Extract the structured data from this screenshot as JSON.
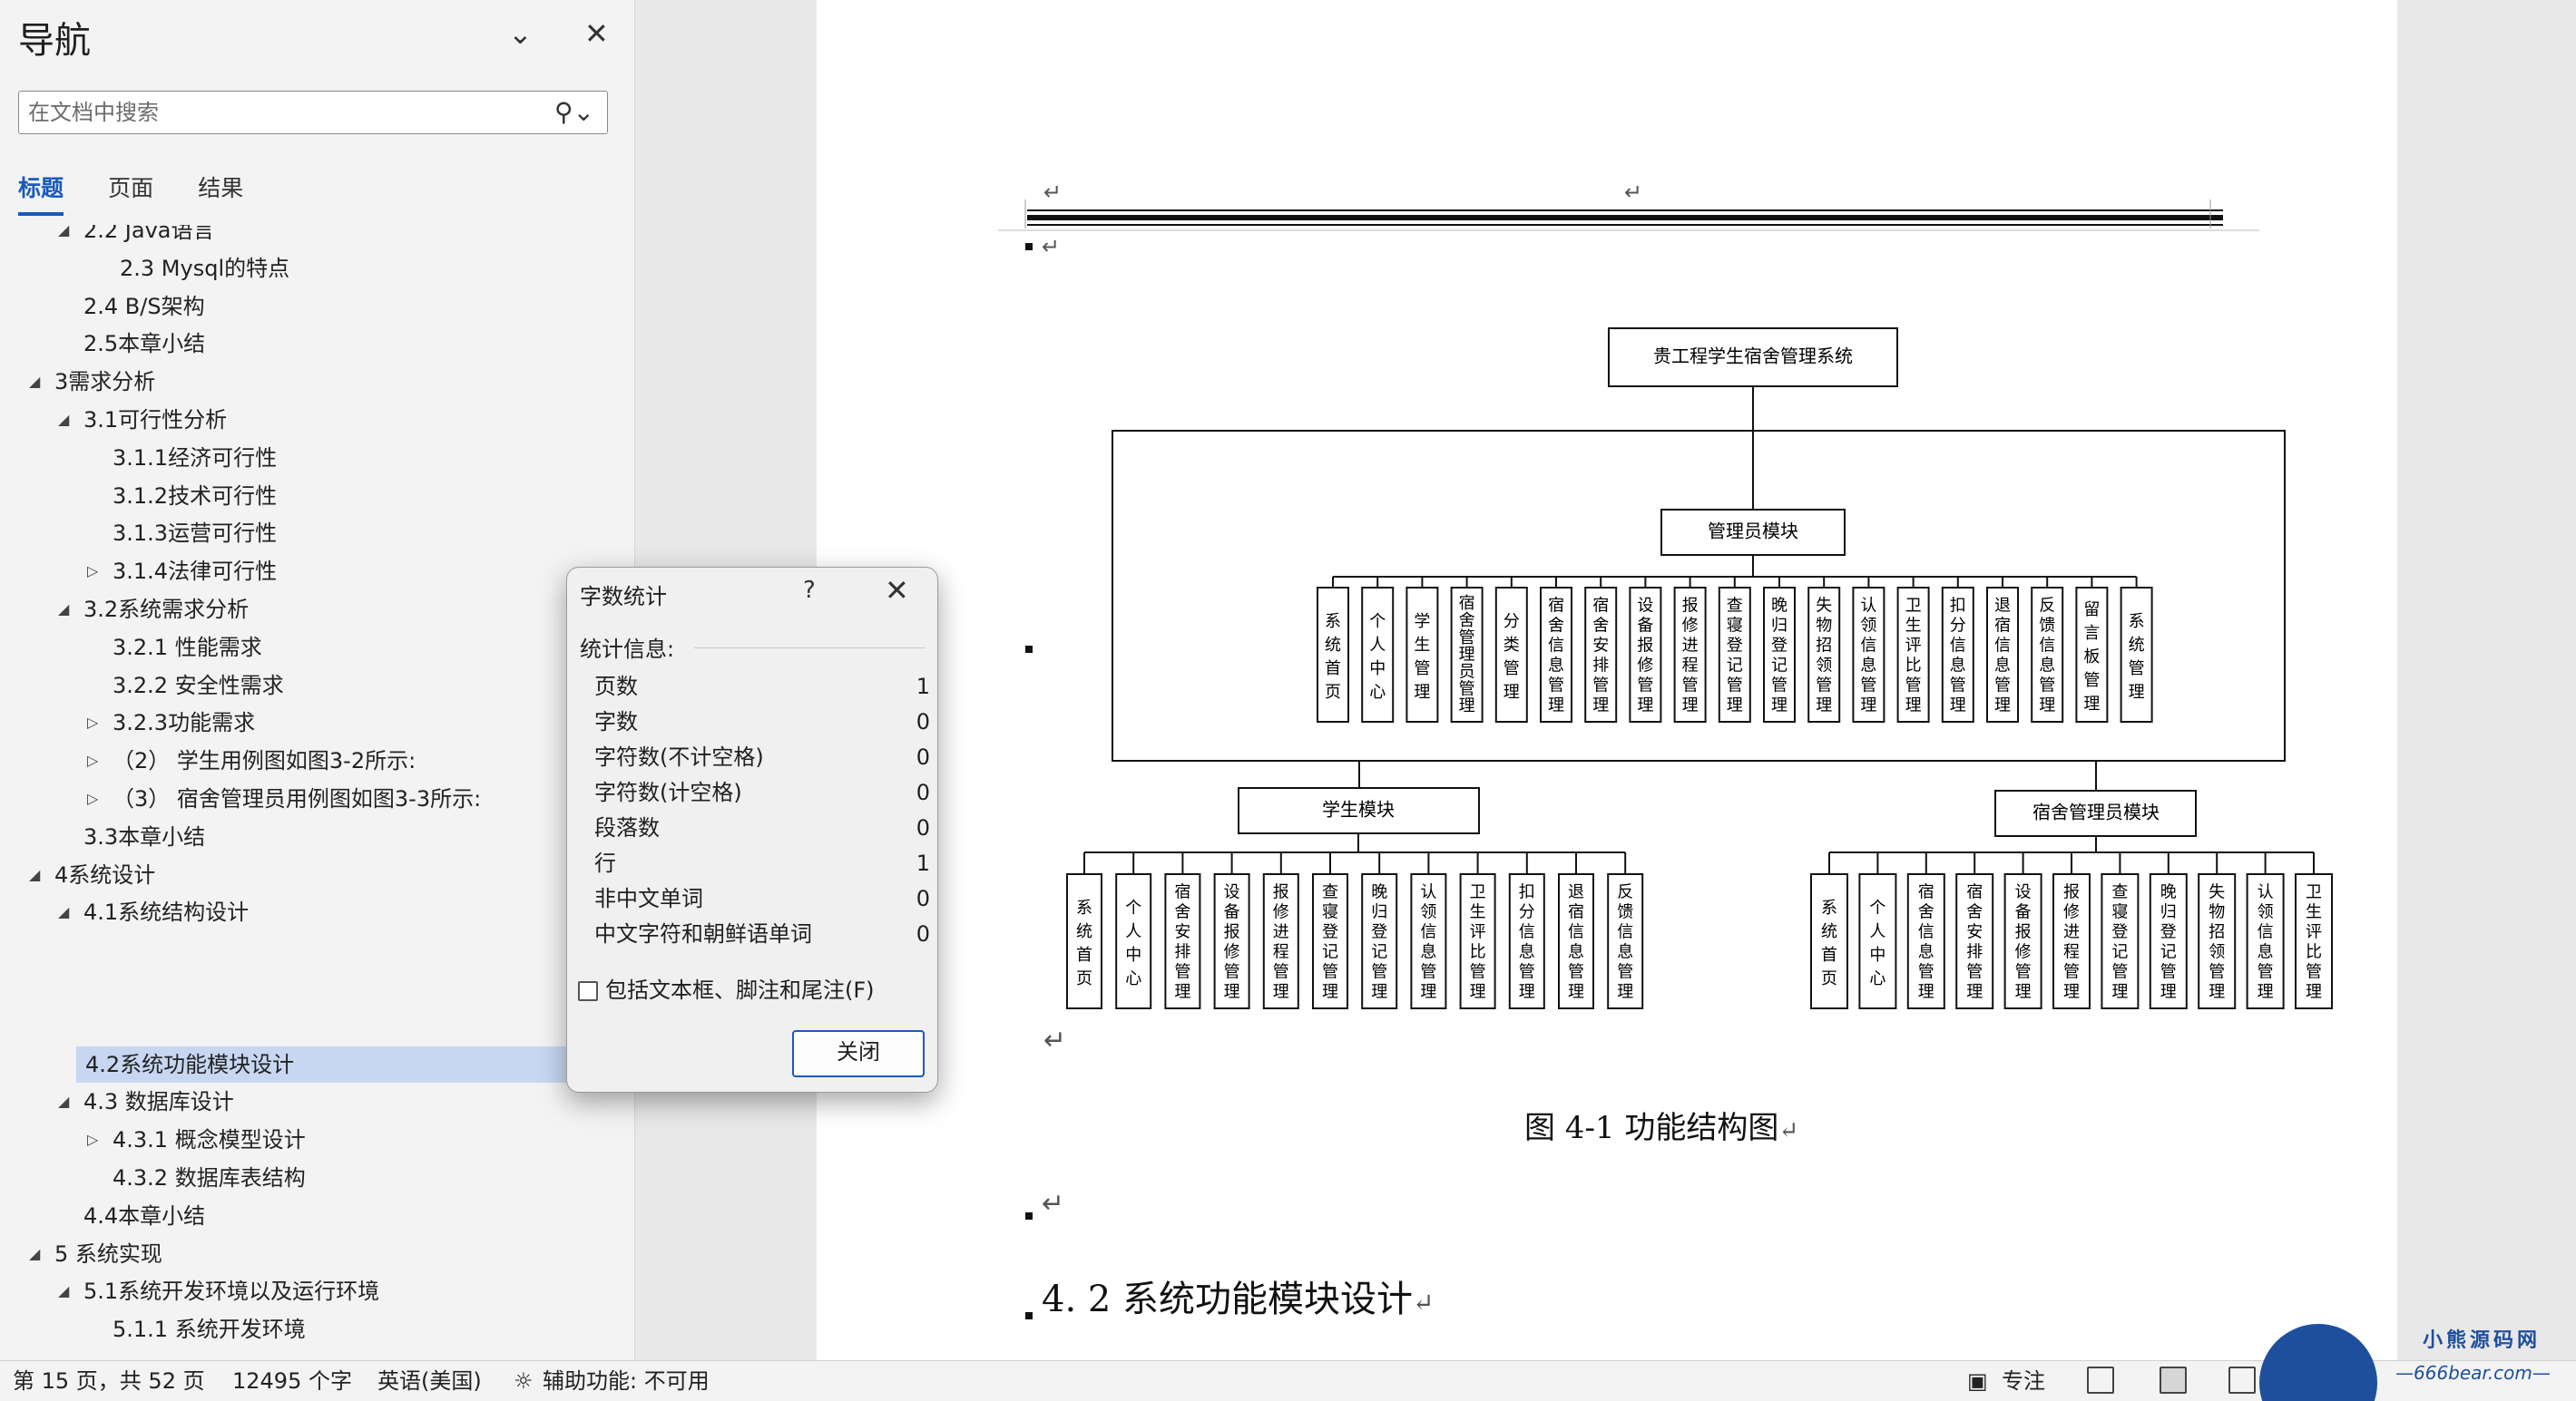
{
  "nav": {
    "title": "导航",
    "search_placeholder": "在文档中搜索",
    "tabs": [
      "标题",
      "页面",
      "结果"
    ],
    "tree": [
      {
        "label": "2.2 Java语言",
        "level": 2,
        "tri": "down"
      },
      {
        "label": "2.3 Mysql的特点",
        "level": 4,
        "tri": ""
      },
      {
        "label": "2.4 B/S架构",
        "level": 2,
        "tri": ""
      },
      {
        "label": "2.5本章小结",
        "level": 2,
        "tri": ""
      },
      {
        "label": "3需求分析",
        "level": 1,
        "tri": "down"
      },
      {
        "label": "3.1可行性分析",
        "level": 2,
        "tri": "down"
      },
      {
        "label": "3.1.1经济可行性",
        "level": 3,
        "tri": ""
      },
      {
        "label": "3.1.2技术可行性",
        "level": 3,
        "tri": ""
      },
      {
        "label": "3.1.3运营可行性",
        "level": 3,
        "tri": ""
      },
      {
        "label": "3.1.4法律可行性",
        "level": 3,
        "tri": "right"
      },
      {
        "label": "3.2系统需求分析",
        "level": 2,
        "tri": "down"
      },
      {
        "label": "3.2.1 性能需求",
        "level": 3,
        "tri": ""
      },
      {
        "label": "3.2.2 安全性需求",
        "level": 3,
        "tri": ""
      },
      {
        "label": "3.2.3功能需求",
        "level": 3,
        "tri": "right"
      },
      {
        "label": "（2） 学生用例图如图3-2所示:",
        "level": 3,
        "tri": "right"
      },
      {
        "label": "（3） 宿舍管理员用例图如图3-3所示:",
        "level": 3,
        "tri": "right"
      },
      {
        "label": "3.3本章小结",
        "level": 2,
        "tri": ""
      },
      {
        "label": "4系统设计",
        "level": 1,
        "tri": "down"
      },
      {
        "label": "4.1系统结构设计",
        "level": 2,
        "tri": "down"
      },
      {
        "label": "",
        "level": 0,
        "tri": ""
      },
      {
        "label": "",
        "level": 0,
        "tri": ""
      },
      {
        "label": "",
        "level": 0,
        "tri": ""
      },
      {
        "label": "4.2系统功能模块设计",
        "level": 2,
        "tri": "",
        "selected": true
      },
      {
        "label": "4.3 数据库设计",
        "level": 2,
        "tri": "down"
      },
      {
        "label": "4.3.1 概念模型设计",
        "level": 3,
        "tri": "right"
      },
      {
        "label": "4.3.2 数据库表结构",
        "level": 3,
        "tri": ""
      },
      {
        "label": "4.4本章小结",
        "level": 2,
        "tri": ""
      },
      {
        "label": "5 系统实现",
        "level": 1,
        "tri": "down"
      },
      {
        "label": "5.1系统开发环境以及运行环境",
        "level": 2,
        "tri": "down"
      },
      {
        "label": "5.1.1 系统开发环境",
        "level": 3,
        "tri": ""
      }
    ]
  },
  "dialog": {
    "title": "字数统计",
    "help": "?",
    "section": "统计信息:",
    "stats": [
      {
        "label": "页数",
        "value": "1"
      },
      {
        "label": "字数",
        "value": "0"
      },
      {
        "label": "字符数(不计空格)",
        "value": "0"
      },
      {
        "label": "字符数(计空格)",
        "value": "0"
      },
      {
        "label": "段落数",
        "value": "0"
      },
      {
        "label": "行",
        "value": "1"
      },
      {
        "label": "非中文单词",
        "value": "0"
      },
      {
        "label": "中文字符和朝鲜语单词",
        "value": "0"
      }
    ],
    "checkbox": "包括文本框、脚注和尾注(F)",
    "close_button": "关闭"
  },
  "document": {
    "diagram": {
      "root": "贵工程学生宿舍管理系统",
      "admin_module": "管理员模块",
      "student_module": "学生模块",
      "manager_module": "宿舍管理员模块",
      "admin_items": [
        "系统首页",
        "个人中心",
        "学生管理",
        "宿舍管理员管理",
        "分类管理",
        "宿舍信息管理",
        "宿舍安排管理",
        "设备报修管理",
        "报修进程管理",
        "查寝登记管理",
        "晚归登记管理",
        "失物招领管理",
        "认领信息管理",
        "卫生评比管理",
        "扣分信息管理",
        "退宿信息管理",
        "反馈信息管理",
        "留言板管理",
        "系统管理"
      ],
      "student_items": [
        "系统首页",
        "个人中心",
        "宿舍安排管理",
        "设备报修管理",
        "报修进程管理",
        "查寝登记管理",
        "晚归登记管理",
        "认领信息管理",
        "卫生评比管理",
        "扣分信息管理",
        "退宿信息管理",
        "反馈信息管理"
      ],
      "manager_items": [
        "系统首页",
        "个人中心",
        "宿舍信息管理",
        "宿舍安排管理",
        "设备报修管理",
        "报修进程管理",
        "查寝登记管理",
        "晚归登记管理",
        "失物招领管理",
        "认领信息管理",
        "卫生评比管理"
      ]
    },
    "caption": "图 4-1 功能结构图",
    "heading": "4. 2 系统功能模块设计",
    "return_mark": "↵"
  },
  "status": {
    "page": "第 15 页，共 52 页",
    "words": "12495 个字",
    "language": "英语(美国)",
    "accessibility": "辅助功能: 不可用",
    "focus": "专注"
  },
  "watermark": {
    "line1": "小熊源码网",
    "line2": "—666bear.com—"
  }
}
